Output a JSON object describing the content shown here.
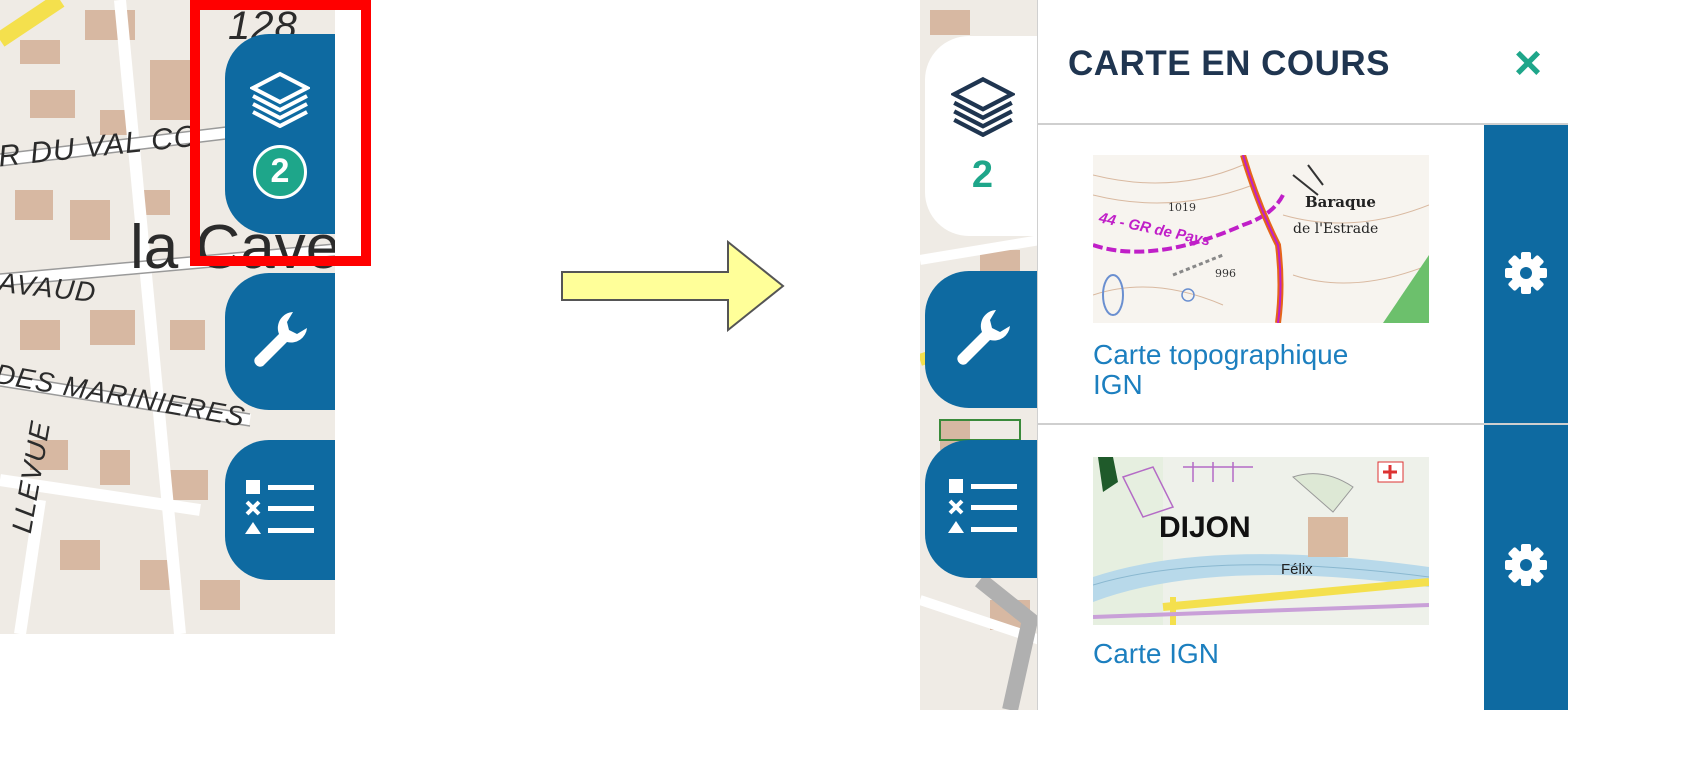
{
  "left_map": {
    "labels": [
      "128",
      "R DU VAL CO",
      "la Cave",
      "AVAUD",
      "DES MARINIERES",
      "LLEVUE"
    ]
  },
  "left_tabs": {
    "layers_icon": "layers-icon",
    "layers_count": "2",
    "tools_icon": "wrench-icon",
    "legend_icon": "legend-list-icon"
  },
  "arrow": {
    "color": "#ffff99"
  },
  "right_tabs": {
    "layers_count": "2"
  },
  "panel": {
    "title": "CARTE EN COURS",
    "close_label": "×",
    "layers": [
      {
        "name_line1": "Carte topographique",
        "name_line2": "IGN",
        "thumb_labels": [
          "1019",
          "44 - GR de Pays",
          "Baraque",
          "de l'Estrade",
          "996"
        ]
      },
      {
        "name_line1": "Carte IGN",
        "name_line2": "",
        "thumb_labels": [
          "DIJON",
          "Félix"
        ]
      }
    ]
  },
  "colors": {
    "tab_blue": "#0e6aa1",
    "accent_green": "#1ea68a",
    "highlight_red": "#ff0000",
    "title_navy": "#1f3550",
    "link_blue": "#1c7fbf"
  }
}
